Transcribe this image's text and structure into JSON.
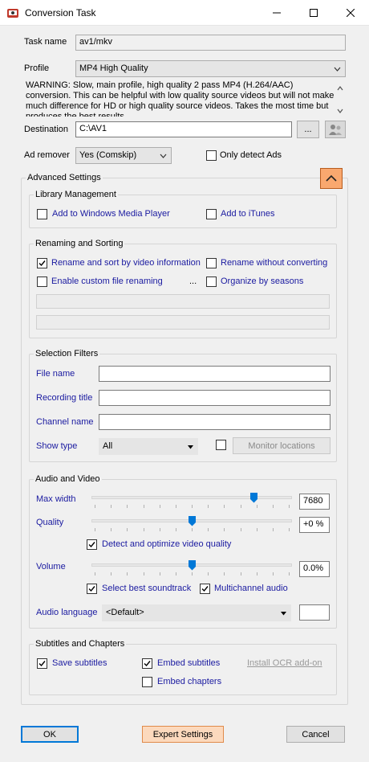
{
  "window": {
    "title": "Conversion Task"
  },
  "task": {
    "label": "Task name",
    "value": "av1/mkv"
  },
  "profile": {
    "label": "Profile",
    "value": "MP4 High Quality",
    "warning": "WARNING: Slow, main profile, high quality 2 pass MP4 (H.264/AAC) conversion. This can be helpful with low quality source videos but will not make much difference for HD or high quality source videos. Takes the most time but produces the best results."
  },
  "destination": {
    "label": "Destination",
    "value": "C:\\AV1",
    "browse_label": "..."
  },
  "ad_remover": {
    "label": "Ad remover",
    "value": "Yes (Comskip)",
    "only_detect_label": "Only detect Ads",
    "only_detect_checked": false
  },
  "advanced": {
    "label": "Advanced Settings"
  },
  "library": {
    "title": "Library Management",
    "wmp_label": "Add to Windows Media Player",
    "wmp_checked": false,
    "itunes_label": "Add to iTunes",
    "itunes_checked": false
  },
  "renaming": {
    "title": "Renaming and Sorting",
    "rename_sort_label": "Rename and sort by video information",
    "rename_sort_checked": true,
    "rename_without_label": "Rename without converting",
    "rename_without_checked": false,
    "custom_label": "Enable custom file renaming",
    "custom_checked": false,
    "custom_ellipsis": "...",
    "seasons_label": "Organize by seasons",
    "seasons_checked": false
  },
  "filters": {
    "title": "Selection Filters",
    "file_name_label": "File name",
    "recording_title_label": "Recording title",
    "channel_name_label": "Channel name",
    "show_type_label": "Show type",
    "show_type_value": "All",
    "monitor_label": "Monitor locations",
    "monitor_checked": false
  },
  "av": {
    "title": "Audio and Video",
    "max_width_label": "Max width",
    "max_width_value": "7680",
    "max_width_level": 0.82,
    "quality_label": "Quality",
    "quality_value": "+0 %",
    "quality_level": 0.5,
    "detect_label": "Detect and optimize video quality",
    "detect_checked": true,
    "volume_label": "Volume",
    "volume_value": "0.0%",
    "volume_level": 0.5,
    "best_sound_label": "Select best soundtrack",
    "best_sound_checked": true,
    "multichannel_label": "Multichannel audio",
    "multichannel_checked": true,
    "audio_lang_label": "Audio language",
    "audio_lang_value": "<Default>"
  },
  "subtitles": {
    "title": "Subtitles and Chapters",
    "save_label": "Save subtitles",
    "save_checked": true,
    "embed_subs_label": "Embed subtitles",
    "embed_subs_checked": true,
    "ocr_label": "Install OCR add-on",
    "embed_chapters_label": "Embed chapters",
    "embed_chapters_checked": false
  },
  "buttons": {
    "ok": "OK",
    "expert": "Expert Settings",
    "cancel": "Cancel"
  },
  "colors": {
    "accent_orange": "#f9a86f",
    "link_blue": "#1a1aa0"
  }
}
